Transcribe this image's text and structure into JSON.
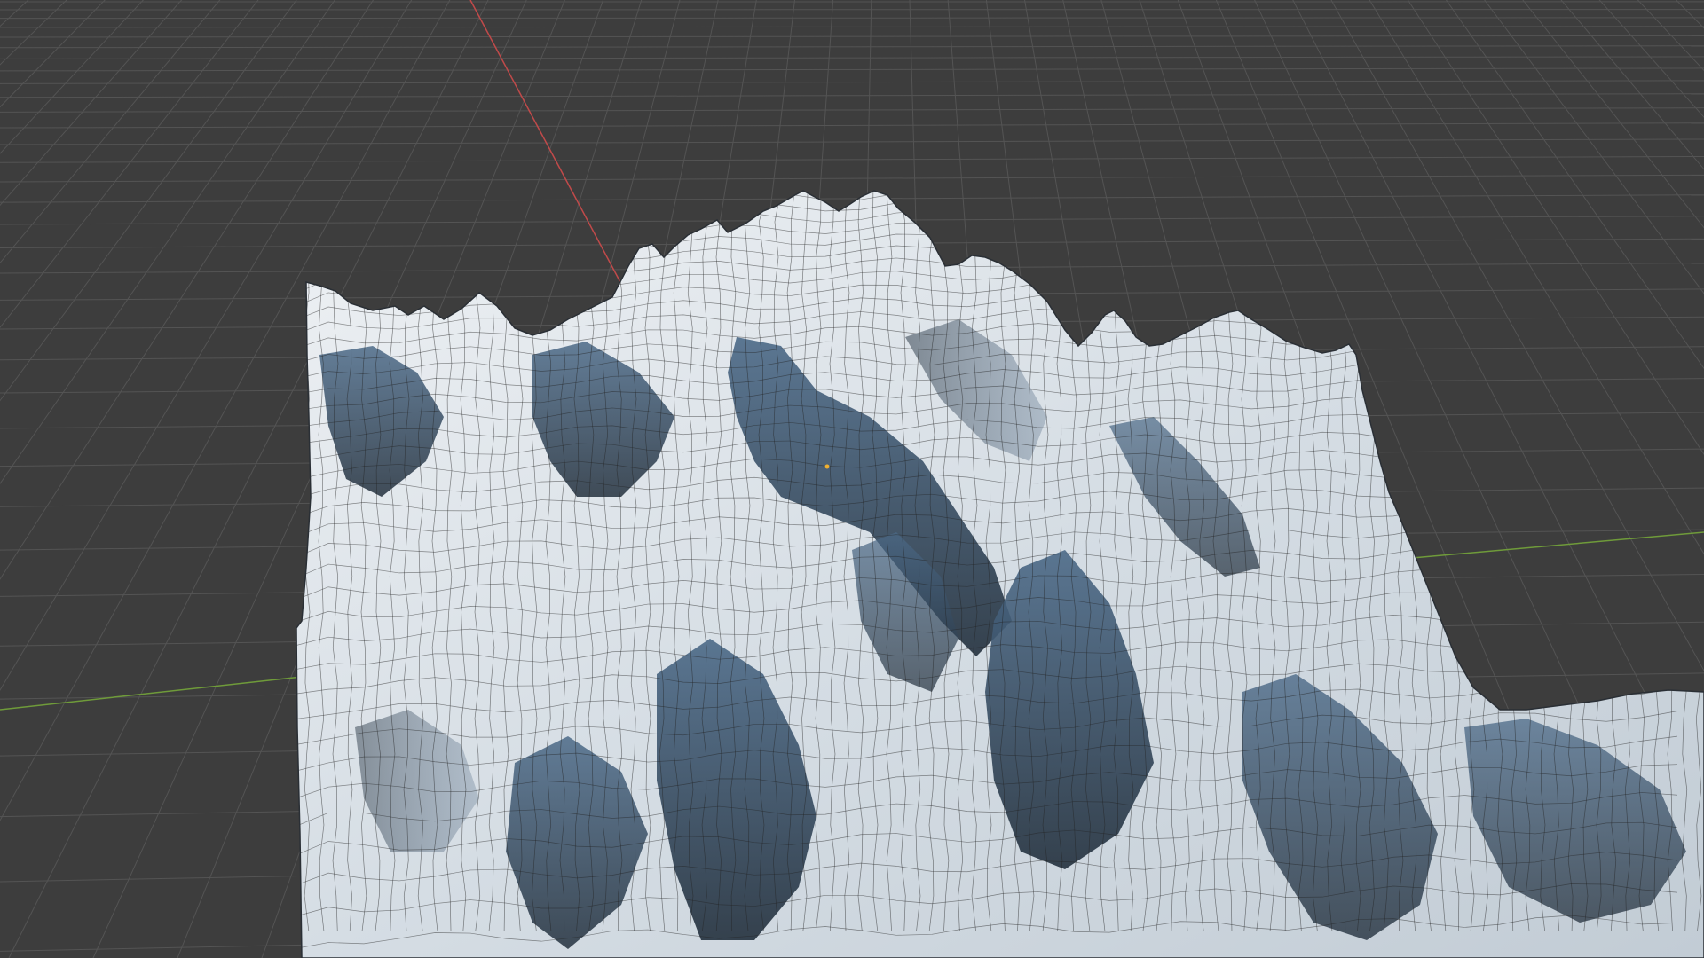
{
  "viewport": {
    "background_color": "#3d3d3d",
    "grid_color": "#545454",
    "x_axis_color": "#c04a4a",
    "y_axis_color": "#6f9b3a",
    "object_icon": "terrain-mesh",
    "object_colors": {
      "snow": "#e6e9ec",
      "snow_shadow": "#b9c3cc",
      "rock_blue": "#3f5670",
      "rock_dark": "#1f2a36",
      "wireframe": "#222222"
    },
    "origin_marker_color": "#f0b030",
    "show_grid": true,
    "show_wireframe": true
  }
}
